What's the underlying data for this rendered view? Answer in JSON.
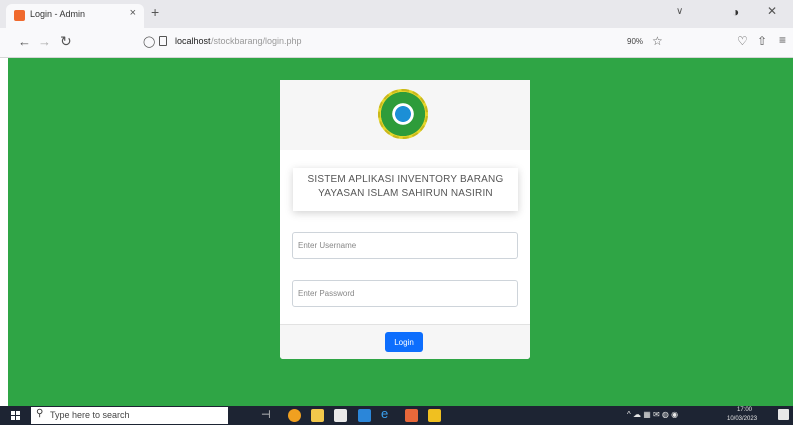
{
  "browser": {
    "tab_title": "Login - Admin",
    "tab_close": "×",
    "new_tab": "+",
    "tabs_menu": "∨",
    "url_host": "localhost",
    "url_path": "/stockbarang/login.php",
    "zoom": "90%"
  },
  "login": {
    "title_line1": "SISTEM APLIKASI INVENTORY BARANG",
    "title_line2": "YAYASAN ISLAM SAHIRUN NASIRIN",
    "username_placeholder": "Enter Username",
    "password_placeholder": "Enter Password",
    "login_label": "Login"
  },
  "taskbar": {
    "search_placeholder": "Type here to search",
    "tray_icons": "^ ☁ ▦ ✉ ◍ ◉",
    "time": "17:00",
    "date": "10/03/2023"
  },
  "colors": {
    "page_background": "#2fa545",
    "login_button": "#0d6efd",
    "taskbar": "#1d2433"
  },
  "icons": [
    "start-icon",
    "search-icon",
    "file-explorer-icon",
    "firefox-icon",
    "mail-icon",
    "store-icon",
    "edge-icon",
    "office-icon",
    "sticky-notes-icon"
  ]
}
